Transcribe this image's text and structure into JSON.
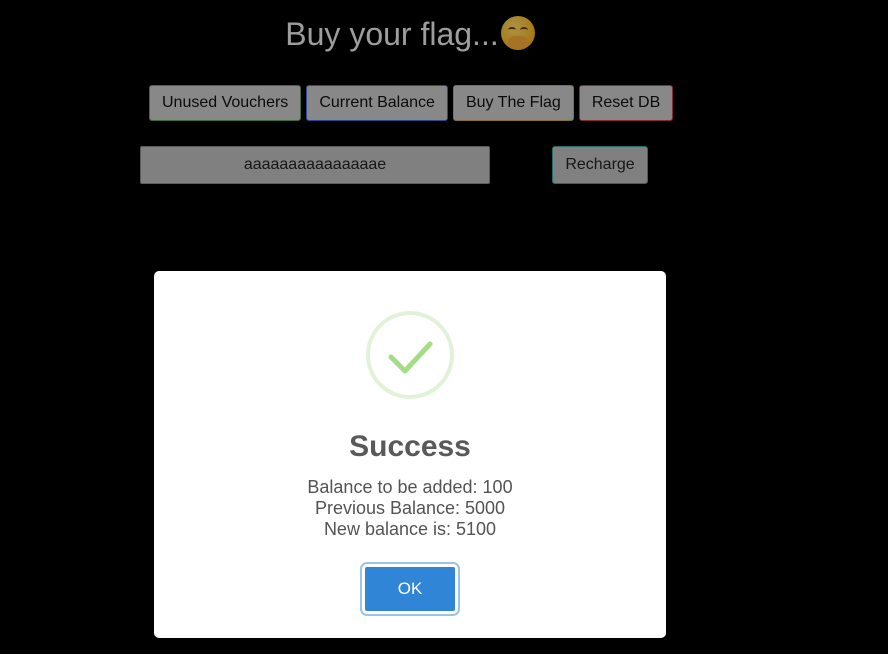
{
  "app": {
    "title": "Buy your flag...",
    "title_emoji": "face-with-hand-over-mouth",
    "buttons": {
      "unused_vouchers": "Unused Vouchers",
      "current_balance": "Current Balance",
      "buy_flag": "Buy The Flag",
      "reset_db": "Reset DB"
    },
    "voucher_input": {
      "value": "aaaaaaaaaaaaaaae"
    },
    "recharge_label": "Recharge"
  },
  "modal": {
    "icon": "success-check-icon",
    "title": "Success",
    "lines": [
      "Balance to be added: 100",
      "Previous Balance: 5000",
      "New balance is: 5100"
    ],
    "ok_label": "OK"
  },
  "colors": {
    "accent": "#3085d6",
    "success": "#a5dc86",
    "overlay": "rgba(0,0,0,0.32)"
  }
}
